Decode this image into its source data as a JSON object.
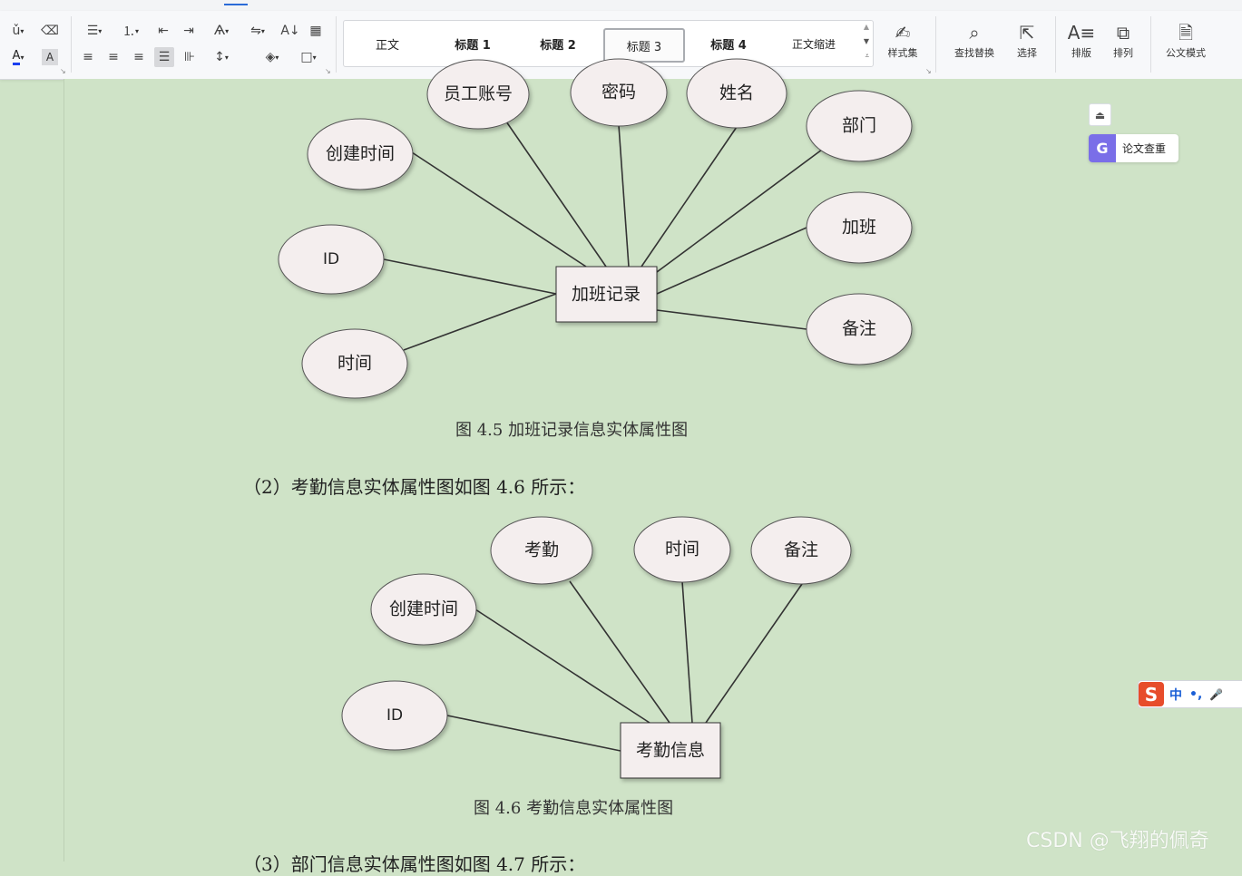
{
  "ribbon": {
    "font_tools": {
      "phonetic": "wén",
      "font_color": "A",
      "char_shade": "A"
    },
    "paragraph_tools": {
      "sort": "A↓",
      "border": "▦"
    },
    "styles": [
      {
        "label": "正文",
        "selected": false
      },
      {
        "label": "标题 1",
        "selected": false
      },
      {
        "label": "标题 2",
        "selected": false
      },
      {
        "label": "标题 3",
        "selected": true
      },
      {
        "label": "标题 4",
        "selected": false
      },
      {
        "label": "正文缩进",
        "selected": false
      }
    ],
    "style_set": "样式集",
    "find_replace": "查找替换",
    "select": "选择",
    "layout": "排版",
    "arrange": "排列",
    "official_mode": "公文模式"
  },
  "diagram1": {
    "entity": "加班记录",
    "attributes": [
      "员工账号",
      "密码",
      "姓名",
      "部门",
      "加班",
      "备注",
      "时间",
      "ID",
      "创建时间"
    ],
    "caption": "图 4.5 加班记录信息实体属性图"
  },
  "paragraph": "（2）考勤信息实体属性图如图 4.6 所示：",
  "diagram2": {
    "entity": "考勤信息",
    "attributes": [
      "考勤",
      "时间",
      "备注",
      "创建时间",
      "ID"
    ],
    "caption": "图 4.6 考勤信息实体属性图"
  },
  "next_paragraph": "（3）部门信息实体属性图如图 4.7 所示：",
  "side_panel": {
    "paper_check": "论文查重"
  },
  "ime": {
    "lang": "中",
    "punct": "•,",
    "mic": "🎤"
  },
  "watermark": "CSDN @飞翔的佩奇",
  "colors": {
    "page_bg": "#cfe3c7",
    "ellipse_fill": "#f4eeee",
    "accent": "#2b6bd8"
  }
}
